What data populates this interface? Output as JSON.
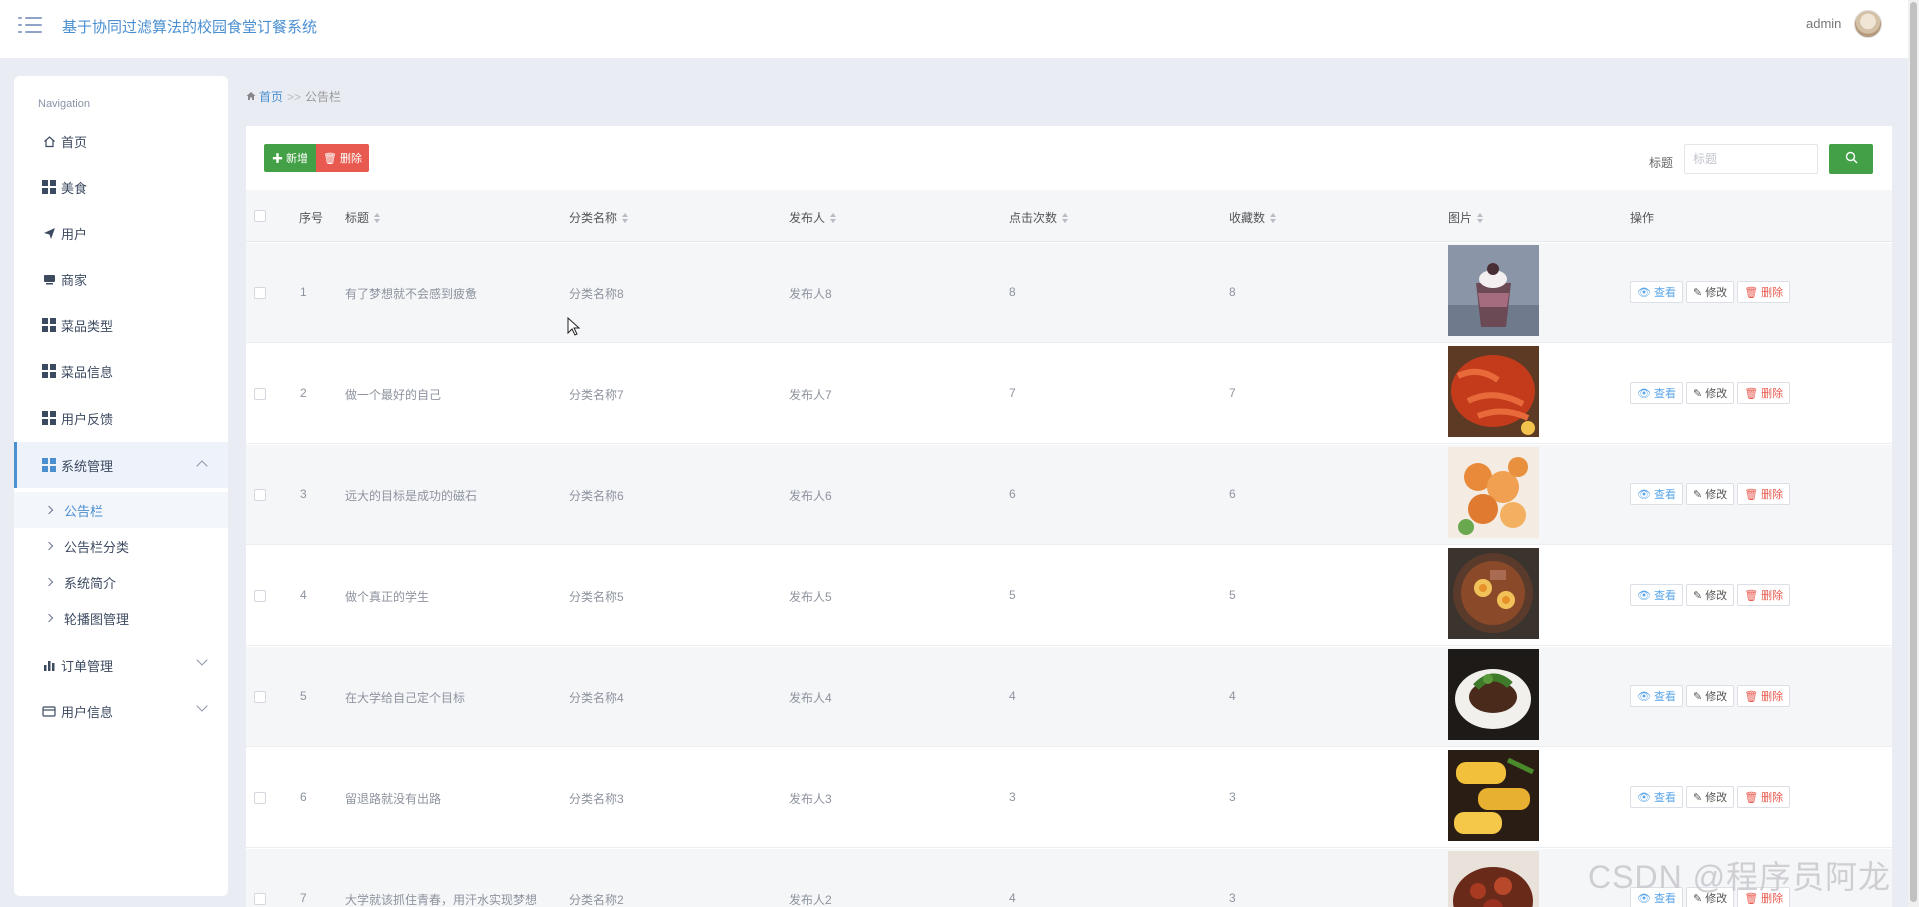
{
  "header": {
    "title": "基于协同过滤算法的校园食堂订餐系统",
    "user": "admin"
  },
  "sidebar": {
    "heading": "Navigation",
    "items": [
      {
        "label": "首页",
        "icon": "home-icon"
      },
      {
        "label": "美食",
        "icon": "grid-icon"
      },
      {
        "label": "用户",
        "icon": "send-icon"
      },
      {
        "label": "商家",
        "icon": "monitor-icon"
      },
      {
        "label": "菜品类型",
        "icon": "grid-icon"
      },
      {
        "label": "菜品信息",
        "icon": "grid-icon"
      },
      {
        "label": "用户反馈",
        "icon": "grid-icon"
      },
      {
        "label": "系统管理",
        "icon": "grid-icon",
        "expanded": true
      },
      {
        "label": "订单管理",
        "icon": "bar-chart-icon"
      },
      {
        "label": "用户信息",
        "icon": "card-icon"
      }
    ],
    "sub_items": [
      "公告栏",
      "公告栏分类",
      "系统简介",
      "轮播图管理"
    ],
    "active_sub": "公告栏"
  },
  "breadcrumb": {
    "home": "首页",
    "sep": ">>",
    "current": "公告栏"
  },
  "toolbar": {
    "add_label": "新增",
    "delete_label": "删除"
  },
  "search": {
    "label": "标题",
    "placeholder": "标题"
  },
  "table": {
    "headers": [
      "序号",
      "标题",
      "分类名称",
      "发布人",
      "点击次数",
      "收藏数",
      "图片",
      "操作"
    ],
    "rows": [
      {
        "no": "1",
        "title": "有了梦想就不会感到疲惫",
        "category": "分类名称8",
        "publisher": "发布人8",
        "clicks": "8",
        "favorites": "8",
        "image": "dessert-cup"
      },
      {
        "no": "2",
        "title": "做一个最好的自己",
        "category": "分类名称7",
        "publisher": "发布人7",
        "clicks": "7",
        "favorites": "7",
        "image": "crayfish"
      },
      {
        "no": "3",
        "title": "远大的目标是成功的磁石",
        "category": "分类名称6",
        "publisher": "发布人6",
        "clicks": "6",
        "favorites": "6",
        "image": "shrimp"
      },
      {
        "no": "4",
        "title": "做个真正的学生",
        "category": "分类名称5",
        "publisher": "发布人5",
        "clicks": "5",
        "favorites": "5",
        "image": "noodle-soup"
      },
      {
        "no": "5",
        "title": "在大学给自己定个目标",
        "category": "分类名称4",
        "publisher": "发布人4",
        "clicks": "4",
        "favorites": "4",
        "image": "braised-dish"
      },
      {
        "no": "6",
        "title": "留退路就没有出路",
        "category": "分类名称3",
        "publisher": "发布人3",
        "clicks": "3",
        "favorites": "3",
        "image": "corn-rolls"
      },
      {
        "no": "7",
        "title": "大学就该抓住青春，用汗水实现梦想",
        "category": "分类名称2",
        "publisher": "发布人2",
        "clicks": "4",
        "favorites": "3",
        "image": "stew"
      }
    ],
    "actions": {
      "view": "查看",
      "edit": "修改",
      "delete": "删除"
    }
  },
  "watermark": "CSDN @程序员阿龙",
  "colors": {
    "accent": "#4a8fd0",
    "success": "#43a047",
    "danger": "#e85a4f"
  }
}
